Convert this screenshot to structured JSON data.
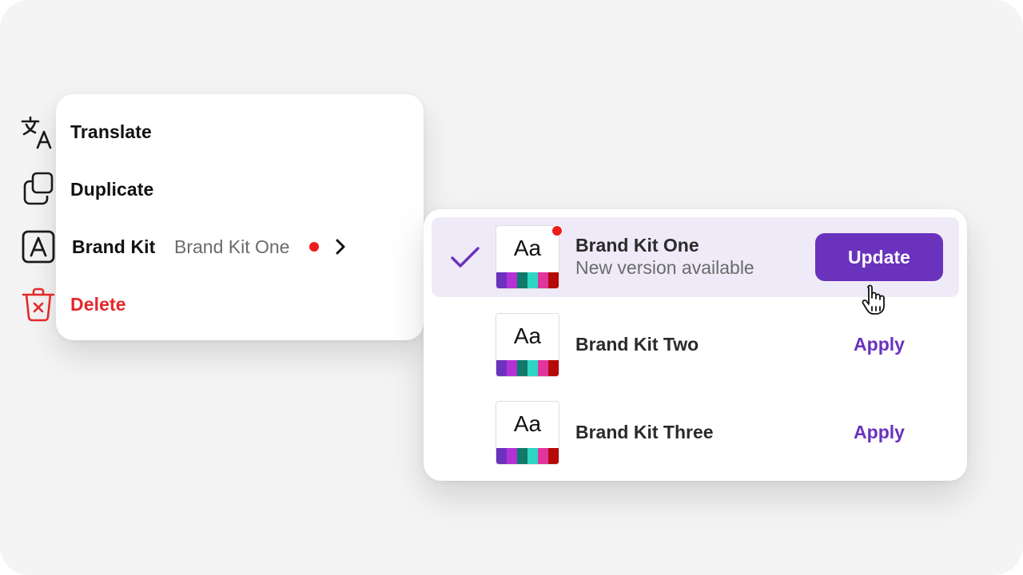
{
  "colors": {
    "background": "#f4f4f4",
    "accent": "#6a32bd",
    "selected_row": "#efeaf7",
    "danger": "#e5282b",
    "notification_dot": "#ee1c1c"
  },
  "menu": {
    "items": [
      {
        "label": "Translate",
        "icon": "translate-icon"
      },
      {
        "label": "Duplicate",
        "icon": "duplicate-icon"
      },
      {
        "label": "Brand Kit",
        "icon": "brand-kit-icon",
        "value": "Brand Kit One",
        "has_update": true,
        "submenu_icon": "chevron-right-icon"
      },
      {
        "label": "Delete",
        "icon": "trash-icon"
      }
    ]
  },
  "brand_kits": {
    "thumbnail_text": "Aa",
    "swatch_colors": [
      "#6a32bd",
      "#b431d6",
      "#0f7a6b",
      "#2ed6c4",
      "#e0359c",
      "#b50a0a"
    ],
    "items": [
      {
        "name": "Brand Kit One",
        "subtitle": "New version available",
        "selected": true,
        "has_update": true,
        "action": "Update"
      },
      {
        "name": "Brand Kit Two",
        "selected": false,
        "action": "Apply"
      },
      {
        "name": "Brand Kit Three",
        "selected": false,
        "action": "Apply"
      }
    ]
  }
}
